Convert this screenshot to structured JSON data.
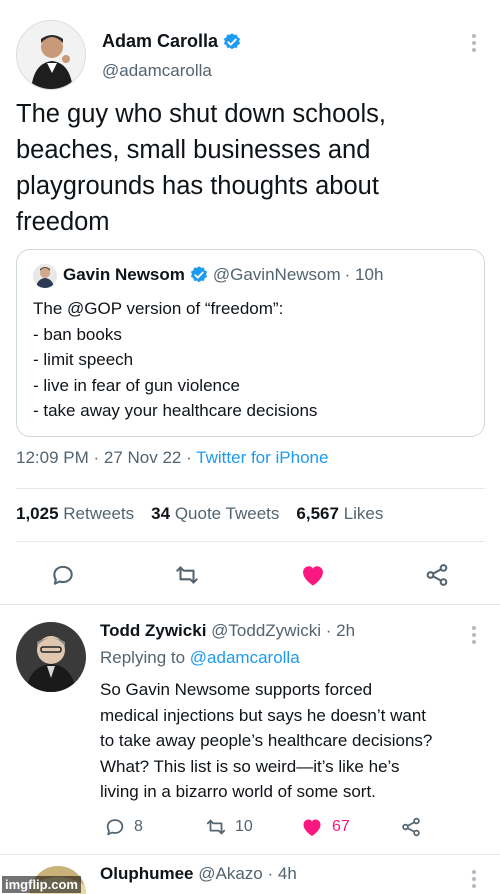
{
  "main_tweet": {
    "author_name": "Adam Carolla",
    "author_handle": "@adamcarolla",
    "text": "The guy who shut down schools, beaches, small businesses and playgrounds has thoughts about freedom",
    "quoted": {
      "author_name": "Gavin Newsom",
      "author_handle": "@GavinNewsom",
      "time": "· 10h",
      "lines": [
        "The @GOP version of “freedom”:",
        "- ban books",
        "- limit speech",
        "- live in fear of gun violence",
        "- take away your healthcare decisions"
      ]
    },
    "timestamp": "12:09 PM · 27 Nov 22 · ",
    "source": "Twitter for iPhone",
    "stats": {
      "retweets_count": "1,025",
      "retweets_label": "Retweets",
      "quotes_count": "34",
      "quotes_label": "Quote Tweets",
      "likes_count": "6,567",
      "likes_label": "Likes"
    }
  },
  "reply": {
    "author_name": "Todd Zywicki",
    "author_handle": "@ToddZywicki",
    "time": "· 2h",
    "replying_label": "Replying to",
    "replying_to": "@adamcarolla",
    "lines": [
      "So Gavin Newsome supports forced",
      "medical injections but says he doesn’t want",
      "to take away people’s healthcare decisions?",
      "What? This list is so weird—it’s like he’s",
      "living in a bizarro world of some sort."
    ],
    "reply_count": "8",
    "retweet_count": "10",
    "like_count": "67"
  },
  "next_reply": {
    "author_name": "Oluphumee",
    "author_handle": "@Akazo",
    "time": "· 4h"
  },
  "watermark": "imgflip.com",
  "colors": {
    "accent": "#1d9bf0",
    "like": "#f91880",
    "muted": "#536471",
    "text": "#0f1419"
  }
}
